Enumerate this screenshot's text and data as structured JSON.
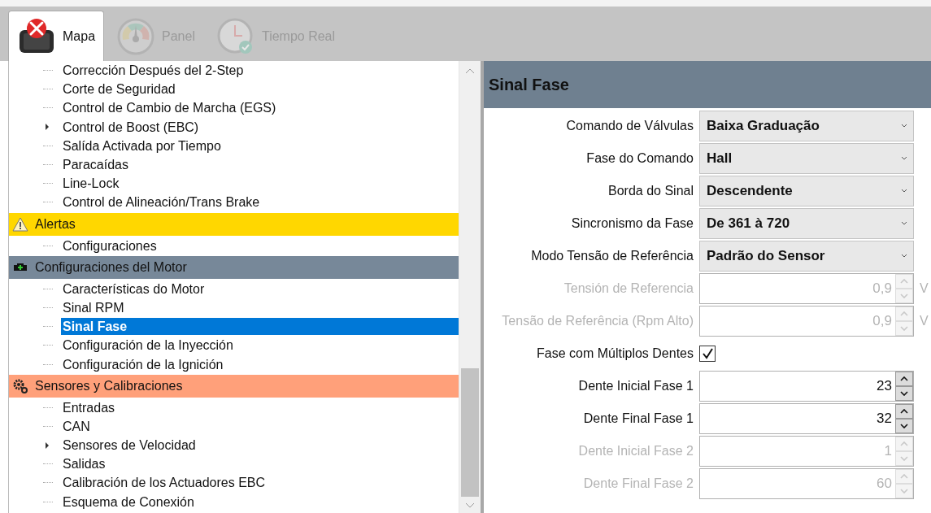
{
  "tabs": [
    {
      "label": "Mapa",
      "kind": "device",
      "selected": true,
      "disabled": false
    },
    {
      "label": "Panel",
      "kind": "gauge",
      "selected": false,
      "disabled": true
    },
    {
      "label": "Tiempo Real",
      "kind": "clock",
      "selected": false,
      "disabled": true
    }
  ],
  "tree": [
    {
      "children": [
        {
          "label": "Corrección Después del 2-Step",
          "expandable": false,
          "selected": false
        },
        {
          "label": "Corte de Seguridad",
          "expandable": false,
          "selected": false
        },
        {
          "label": "Control de Cambio de Marcha (EGS)",
          "expandable": false,
          "selected": false
        },
        {
          "label": "Control de Boost (EBC)",
          "expandable": true,
          "selected": false
        },
        {
          "label": "Salída Activada por Tiempo",
          "expandable": false,
          "selected": false
        },
        {
          "label": "Paracaídas",
          "expandable": false,
          "selected": false
        },
        {
          "label": "Line-Lock",
          "expandable": false,
          "selected": false
        },
        {
          "label": "Control de Alineación/Trans Brake",
          "expandable": false,
          "selected": false
        }
      ]
    },
    {
      "label": "Alertas",
      "kind": "warning",
      "color": "#ffd700",
      "children": [
        {
          "label": "Configuraciones",
          "expandable": false,
          "selected": false
        }
      ]
    },
    {
      "label": "Configuraciones del Motor",
      "kind": "engine",
      "color": "#778899",
      "children": [
        {
          "label": "Características do Motor",
          "expandable": false,
          "selected": false
        },
        {
          "label": "Sinal RPM",
          "expandable": false,
          "selected": false
        },
        {
          "label": "Sinal Fase",
          "expandable": false,
          "selected": true
        },
        {
          "label": "Configuración de la Inyección",
          "expandable": false,
          "selected": false
        },
        {
          "label": "Configuración de la Ignición",
          "expandable": false,
          "selected": false
        }
      ]
    },
    {
      "label": "Sensores y Calibraciones",
      "kind": "gears",
      "color": "#ffa07a",
      "children": [
        {
          "label": "Entradas",
          "expandable": false,
          "selected": false
        },
        {
          "label": "CAN",
          "expandable": false,
          "selected": false
        },
        {
          "label": "Sensores de Velocidad",
          "expandable": true,
          "selected": false
        },
        {
          "label": "Salidas",
          "expandable": false,
          "selected": false
        },
        {
          "label": "Calibración de los Actuadores EBC",
          "expandable": false,
          "selected": false
        },
        {
          "label": "Esquema de Conexión",
          "expandable": false,
          "selected": false
        }
      ]
    }
  ],
  "panel": {
    "title": "Sinal Fase",
    "fields": [
      {
        "kind": "select",
        "label": "Comando de Válvulas",
        "value": "Baixa Graduação",
        "disabled": false
      },
      {
        "kind": "select",
        "label": "Fase do Comando",
        "value": "Hall",
        "disabled": false
      },
      {
        "kind": "select",
        "label": "Borda do Sinal",
        "value": "Descendente",
        "disabled": false
      },
      {
        "kind": "select",
        "label": "Sincronismo da Fase",
        "value": "De 361 à 720",
        "disabled": false
      },
      {
        "kind": "select",
        "label": "Modo Tensão de Referência",
        "value": "Padrão do Sensor",
        "disabled": false
      },
      {
        "kind": "number",
        "label": "Tensión de Referencia",
        "value": "0,9",
        "unit": "V",
        "disabled": true
      },
      {
        "kind": "number",
        "label": "Tensão de Referência (Rpm Alto)",
        "value": "0,9",
        "unit": "V",
        "disabled": true
      },
      {
        "kind": "checkbox",
        "label": "Fase com Múltiplos Dentes",
        "checked": true,
        "disabled": false
      },
      {
        "kind": "number",
        "label": "Dente Inicial Fase 1",
        "value": "23",
        "disabled": false
      },
      {
        "kind": "number",
        "label": "Dente Final Fase 1",
        "value": "32",
        "disabled": false
      },
      {
        "kind": "number",
        "label": "Dente Inicial Fase 2",
        "value": "1",
        "disabled": true
      },
      {
        "kind": "number",
        "label": "Dente Final Fase 2",
        "value": "60",
        "disabled": true
      }
    ]
  }
}
